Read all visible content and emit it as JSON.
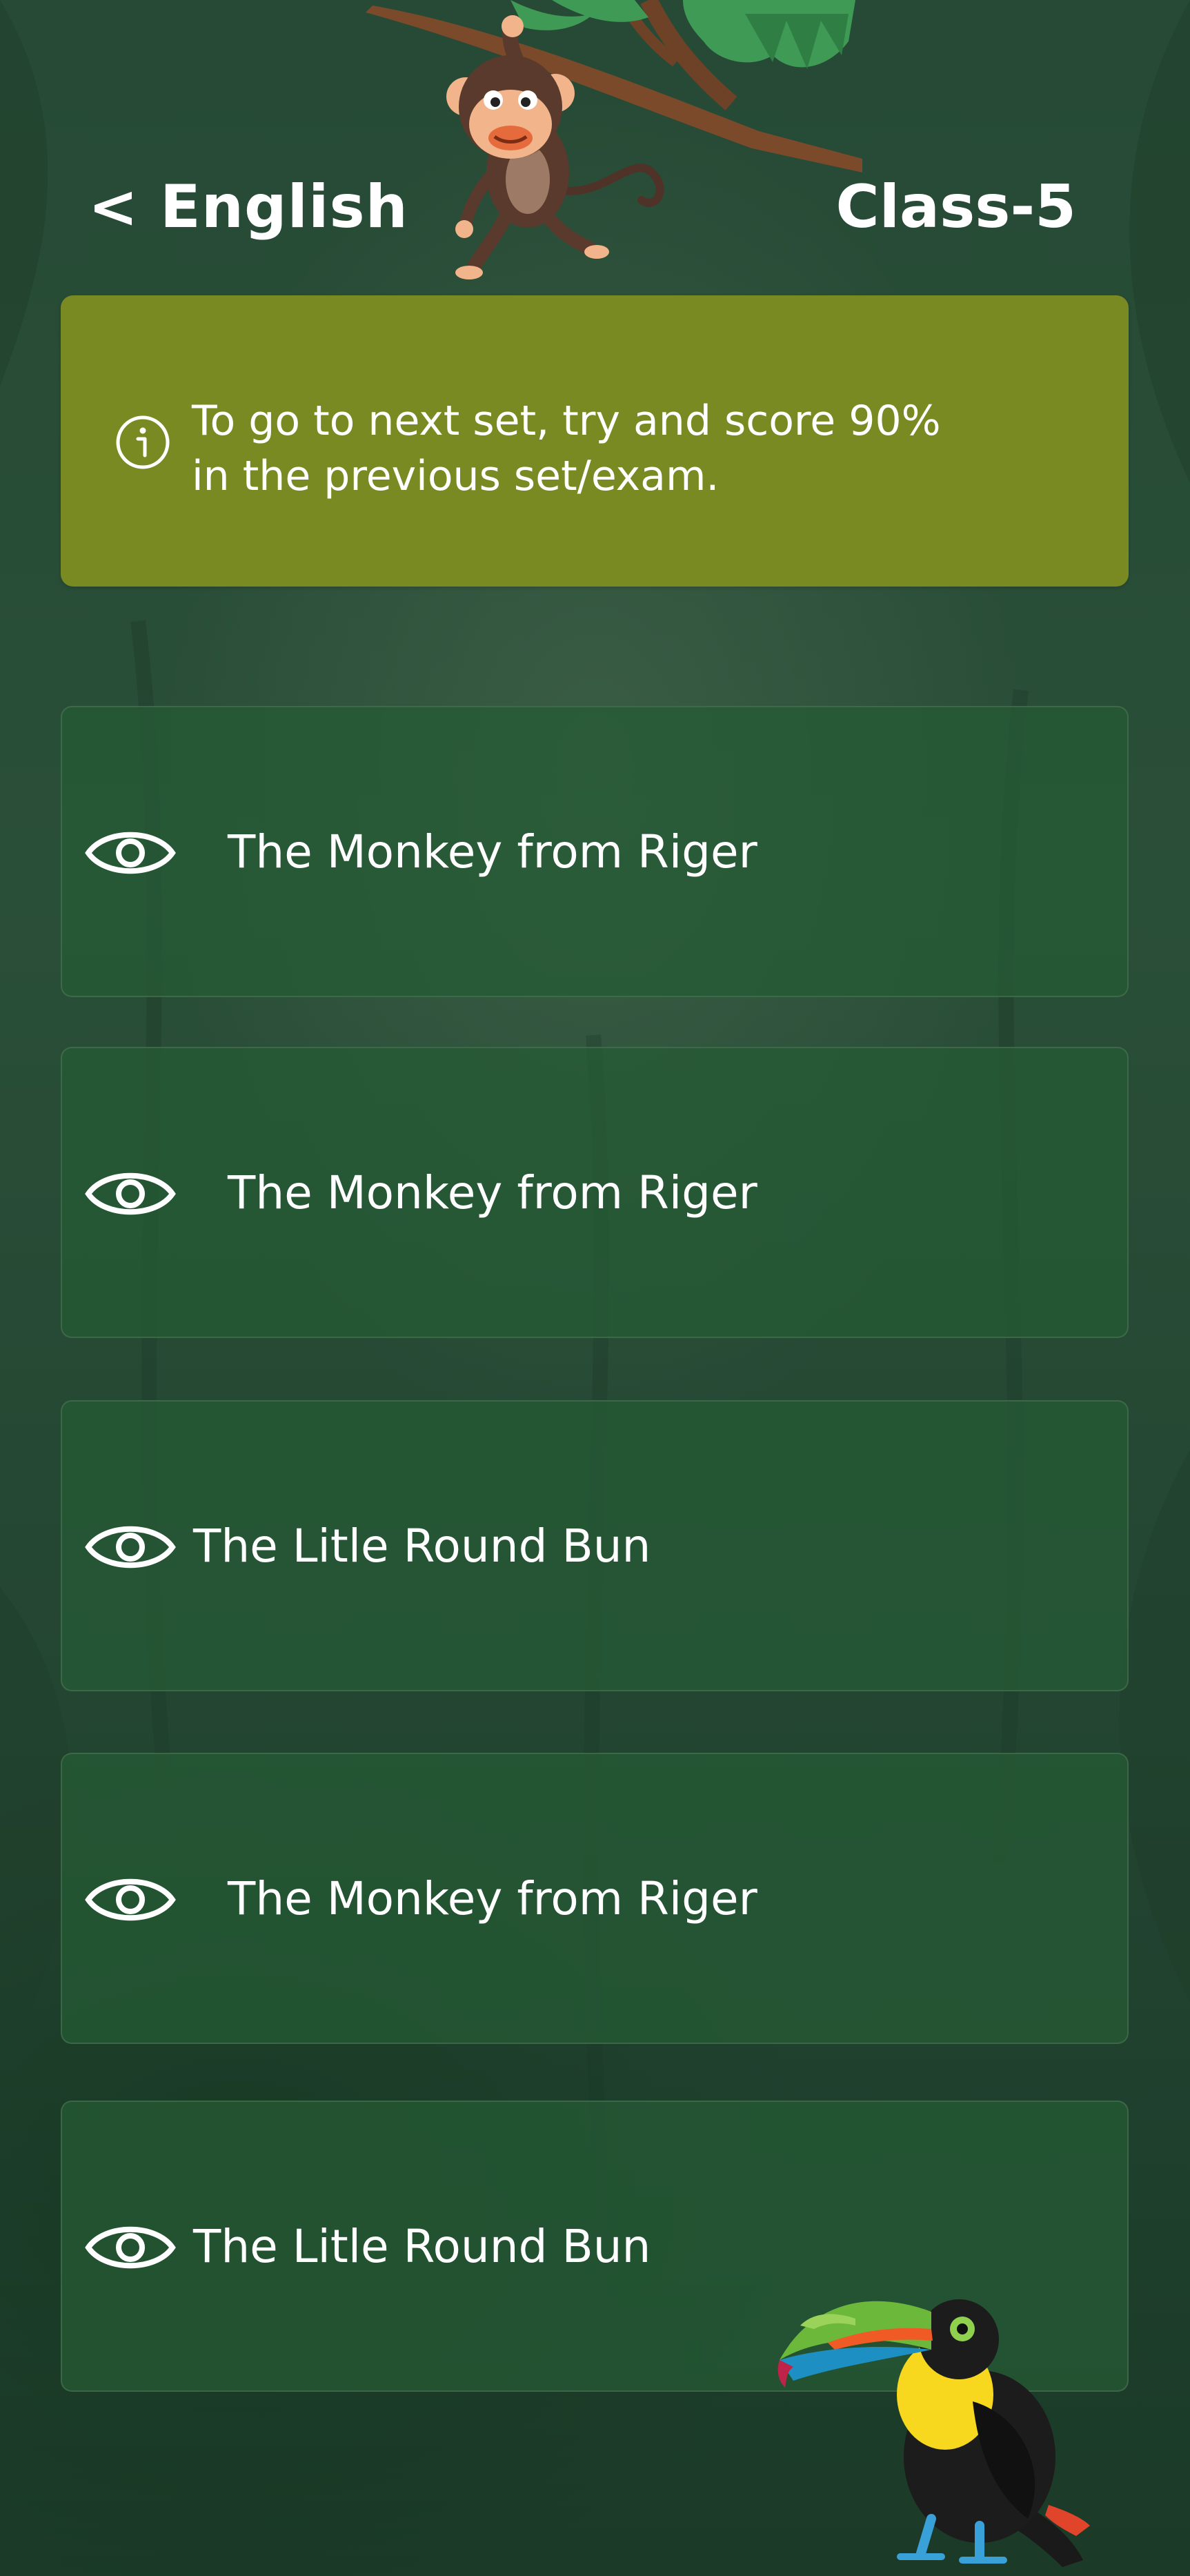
{
  "header": {
    "back_label": "< English",
    "class_label": "Class-5"
  },
  "info_banner": {
    "icon": "info-icon",
    "text_line1": "To go to next set, try and score 90%",
    "text_line2": "in the previous set/exam."
  },
  "sets": [
    {
      "icon": "eye-icon",
      "title": "The Monkey from Riger"
    },
    {
      "icon": "eye-icon",
      "title": "The Monkey from Riger"
    },
    {
      "icon": "eye-icon",
      "title": "The Litle Round Bun"
    },
    {
      "icon": "eye-icon",
      "title": "The Monkey from Riger"
    },
    {
      "icon": "eye-icon",
      "title": "The Litle Round Bun"
    }
  ],
  "colors": {
    "background": "#264a35",
    "banner": "#7a8a23",
    "card": "#265c34",
    "text": "#ffffff"
  }
}
